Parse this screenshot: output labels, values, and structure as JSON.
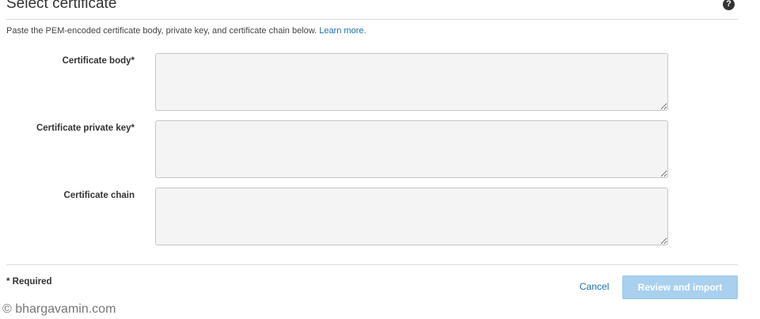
{
  "header": {
    "title": "Select certificate",
    "help_icon": "question-circle-icon"
  },
  "description": {
    "text": "Paste the PEM-encoded certificate body, private key, and certificate chain below.",
    "link_text": "Learn more."
  },
  "fields": [
    {
      "label": "Certificate body*",
      "value": ""
    },
    {
      "label": "Certificate private key*",
      "value": ""
    },
    {
      "label": "Certificate chain",
      "value": ""
    }
  ],
  "footer": {
    "required_note": "* Required",
    "cancel_label": "Cancel",
    "submit_label": "Review and import"
  },
  "watermark": "© bhargavamin.com",
  "colors": {
    "link": "#1a6fa8",
    "primary_button_disabled": "#a9d0ef",
    "textarea_bg": "#f4f4f4"
  }
}
